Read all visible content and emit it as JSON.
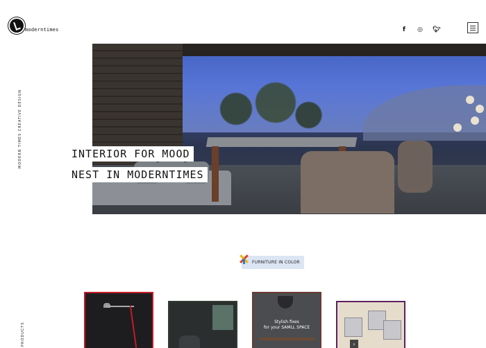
{
  "header": {
    "logo_text": "moderntimes",
    "social": [
      {
        "icon": "facebook-icon",
        "glyph": "f"
      },
      {
        "icon": "instagram-icon",
        "glyph": "◎"
      },
      {
        "icon": "twitter-icon",
        "glyph": "🐦"
      }
    ],
    "menu_icon": "hamburger-icon"
  },
  "side_labels": {
    "brand": "MODERN TIMES CREATIVE DESIGN",
    "section": "PRODUCTS"
  },
  "hero": {
    "line1": "INTERIOR FOR MOOD",
    "line2": "NEST IN MODERNTIMES"
  },
  "section": {
    "tag": "FURNITURE IN COLOR"
  },
  "products": [
    {
      "frame_color": "#c41a2a"
    },
    {
      "frame_color": "#2e3b30"
    },
    {
      "frame_color": "#6b3a33",
      "caption_line1": "Stylish fixes",
      "caption_line2": "for your SAMLL SPACE"
    },
    {
      "frame_color": "#5b1f5e"
    }
  ]
}
